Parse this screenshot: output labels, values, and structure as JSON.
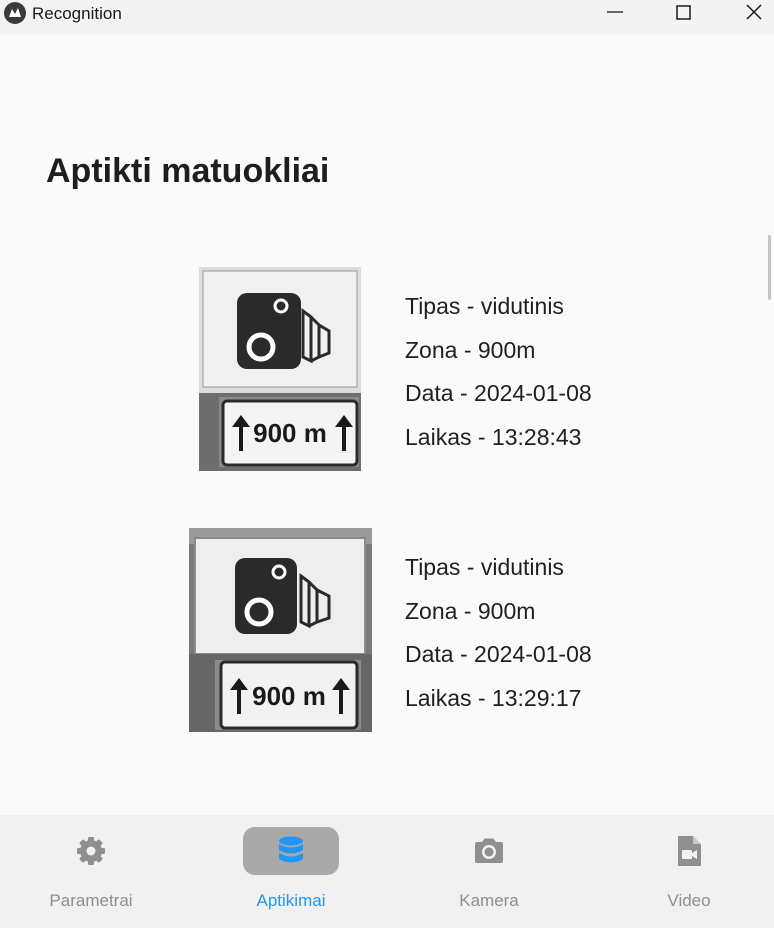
{
  "window": {
    "title": "Recognition"
  },
  "page": {
    "title": "Aptikti matuokliai"
  },
  "detections": [
    {
      "type": "Tipas - vidutinis",
      "zone": "Zona - 900m",
      "date": "Data - 2024-01-08",
      "time": "Laikas - 13:28:43",
      "sign_distance_label": "900 m"
    },
    {
      "type": "Tipas - vidutinis",
      "zone": "Zona - 900m",
      "date": "Data - 2024-01-08",
      "time": "Laikas - 13:29:17",
      "sign_distance_label": "900 m"
    }
  ],
  "nav": {
    "items": [
      {
        "label": "Parametrai",
        "icon": "gear-icon"
      },
      {
        "label": "Aptikimai",
        "icon": "database-icon",
        "active": true
      },
      {
        "label": "Kamera",
        "icon": "camera-icon"
      },
      {
        "label": "Video",
        "icon": "video-file-icon"
      }
    ]
  },
  "colors": {
    "accent": "#2196f3",
    "nav_inactive": "#8f8f8f",
    "active_pill": "#a8a8a8"
  }
}
